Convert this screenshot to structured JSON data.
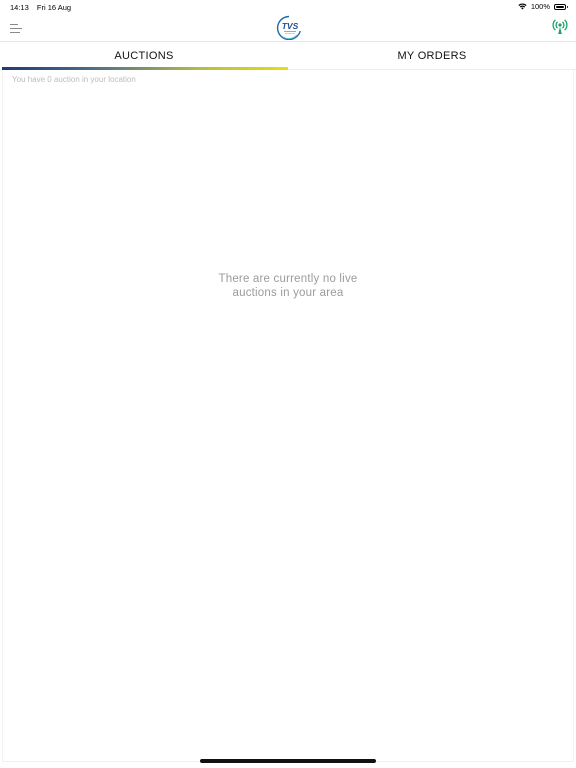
{
  "status_bar": {
    "time": "14:13",
    "date": "Fri 16 Aug",
    "battery": "100%"
  },
  "header": {
    "menu_icon": "menu-icon",
    "logo_text": "TVS",
    "live_icon": "broadcast-icon",
    "brand_color": "#1f6aa5",
    "live_color": "#1aa36b"
  },
  "tabs": [
    {
      "label": "AUCTIONS",
      "selected": true
    },
    {
      "label": "MY ORDERS",
      "selected": false
    }
  ],
  "main": {
    "auction_count_text": "You have 0 auction in your location",
    "empty_message_line1": "There are currently no live",
    "empty_message_line2": "auctions in your area"
  }
}
